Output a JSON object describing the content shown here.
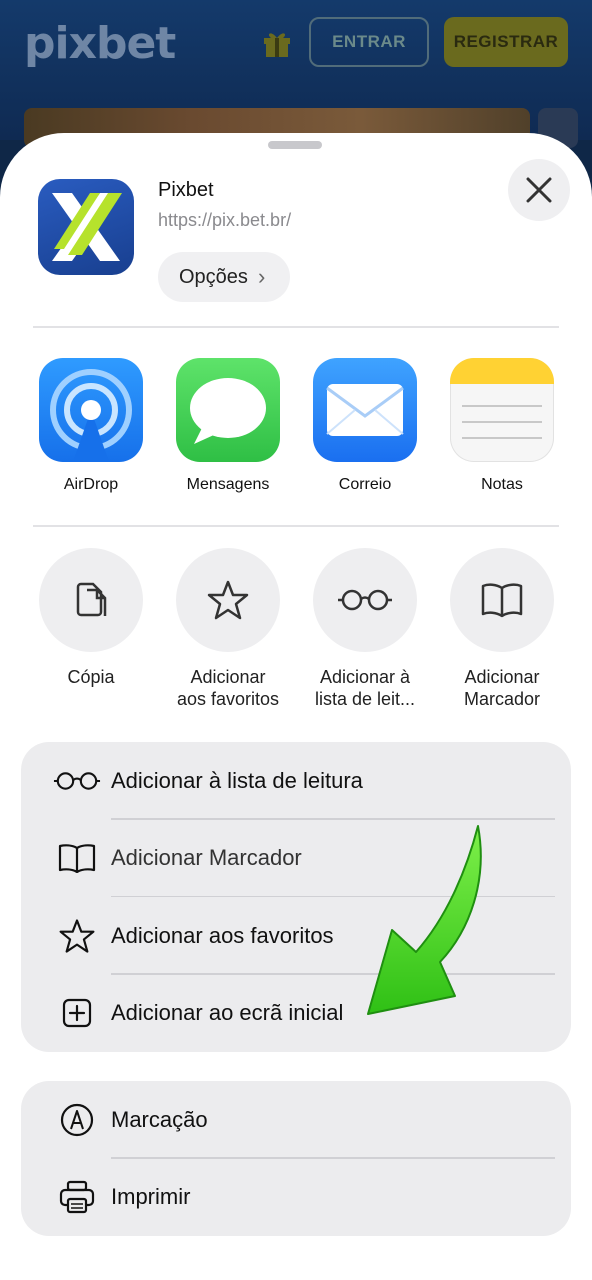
{
  "site": {
    "logo": "pixbet",
    "login_label": "ENTRAR",
    "register_label": "REGISTRAR"
  },
  "share_header": {
    "app_name": "Pixbet",
    "url": "https://pix.bet.br/",
    "options_label": "Opções"
  },
  "apps": [
    {
      "label": "AirDrop",
      "icon": "airdrop-icon"
    },
    {
      "label": "Mensagens",
      "icon": "messages-icon"
    },
    {
      "label": "Correio",
      "icon": "mail-icon"
    },
    {
      "label": "Notas",
      "icon": "notes-icon"
    }
  ],
  "actions": [
    {
      "line1": "Cópia",
      "line2": "",
      "icon": "copy-icon"
    },
    {
      "line1": "Adicionar",
      "line2": "aos favoritos",
      "icon": "star-icon"
    },
    {
      "line1": "Adicionar à",
      "line2": "lista de leit...",
      "icon": "glasses-icon"
    },
    {
      "line1": "Adicionar",
      "line2": "Marcador",
      "icon": "book-icon"
    }
  ],
  "menu_group_1": [
    {
      "label": "Adicionar à lista de leitura",
      "icon": "glasses-icon"
    },
    {
      "label": "Adicionar Marcador",
      "icon": "book-icon"
    },
    {
      "label": "Adicionar aos favoritos",
      "icon": "star-icon"
    },
    {
      "label": "Adicionar ao ecrã inicial",
      "icon": "add-square-icon"
    }
  ],
  "menu_group_2": [
    {
      "label": "Marcação",
      "icon": "markup-icon"
    },
    {
      "label": "Imprimir",
      "icon": "printer-icon"
    }
  ],
  "colors": {
    "site_bg": "#0f2747",
    "arrow_green": "#3fd11a",
    "airdrop_blue": "#1e88f5",
    "messages_green": "#34c759"
  }
}
